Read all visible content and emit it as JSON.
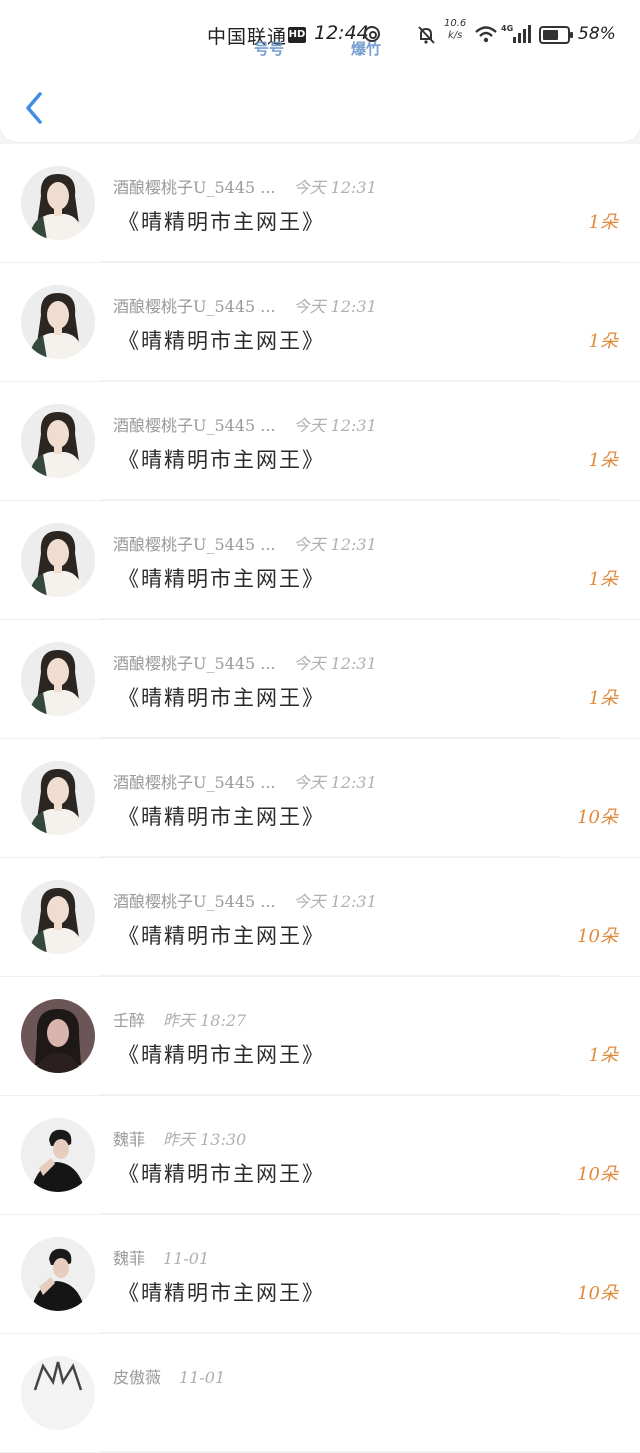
{
  "status_bar": {
    "carrier": "中国联通",
    "hd": "HD",
    "time": "12:44",
    "watermark_left": "号号",
    "watermark_right": "爆竹",
    "net_speed": "10.6\nk/s",
    "net_type": "4G",
    "battery_pct": "58%"
  },
  "header": {
    "back_icon": "chevron-left-icon",
    "accent": "#3f8ee6"
  },
  "colors": {
    "count": "#e08a3c",
    "meta": "#9a9a9a"
  },
  "items": [
    {
      "name": "酒酿樱桃子U_5445 ...",
      "time": "今天 12:31",
      "title": "《晴精明市主网王》",
      "count": "1朵",
      "avatar": "girl-white-jacket"
    },
    {
      "name": "酒酿樱桃子U_5445 ...",
      "time": "今天 12:31",
      "title": "《晴精明市主网王》",
      "count": "1朵",
      "avatar": "girl-white-jacket"
    },
    {
      "name": "酒酿樱桃子U_5445 ...",
      "time": "今天 12:31",
      "title": "《晴精明市主网王》",
      "count": "1朵",
      "avatar": "girl-white-jacket"
    },
    {
      "name": "酒酿樱桃子U_5445 ...",
      "time": "今天 12:31",
      "title": "《晴精明市主网王》",
      "count": "1朵",
      "avatar": "girl-white-jacket"
    },
    {
      "name": "酒酿樱桃子U_5445 ...",
      "time": "今天 12:31",
      "title": "《晴精明市主网王》",
      "count": "1朵",
      "avatar": "girl-white-jacket"
    },
    {
      "name": "酒酿樱桃子U_5445 ...",
      "time": "今天 12:31",
      "title": "《晴精明市主网王》",
      "count": "10朵",
      "avatar": "girl-white-jacket"
    },
    {
      "name": "酒酿樱桃子U_5445 ...",
      "time": "今天 12:31",
      "title": "《晴精明市主网王》",
      "count": "10朵",
      "avatar": "girl-white-jacket"
    },
    {
      "name": "壬醉",
      "time": "昨天 18:27",
      "title": "《晴精明市主网王》",
      "count": "1朵",
      "avatar": "girl-dark"
    },
    {
      "name": "魏菲",
      "time": "昨天 13:30",
      "title": "《晴精明市主网王》",
      "count": "10朵",
      "avatar": "boy-black"
    },
    {
      "name": "魏菲",
      "time": "11-01",
      "title": "《晴精明市主网王》",
      "count": "10朵",
      "avatar": "boy-black"
    },
    {
      "name": "皮傲薇",
      "time": "11-01",
      "title": "",
      "count": "",
      "avatar": "crown"
    }
  ]
}
